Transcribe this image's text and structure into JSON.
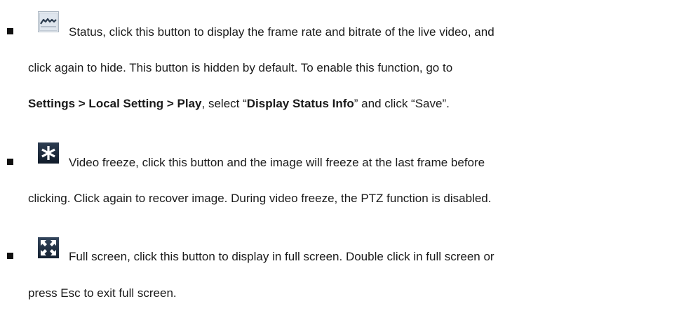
{
  "items": [
    {
      "icon": "status-waveform-icon",
      "line1": "Status, click this button to display the frame rate and bitrate of the live video, and",
      "line2": "click again to hide. This button is hidden by default. To enable this function, go to",
      "line3": {
        "path": "Settings > Local Setting > Play",
        "mid1": ", select “",
        "option": "Display Status Info",
        "mid2": "” and click “Save”."
      }
    },
    {
      "icon": "video-freeze-asterisk-icon",
      "line1": "Video freeze, click this button and the image will freeze at the last frame before",
      "line2": "clicking. Click again to recover image. During video freeze, the PTZ function is disabled."
    },
    {
      "icon": "full-screen-arrows-icon",
      "line1": "Full screen, click this button to display in full screen. Double click in full screen or",
      "line2": "press Esc to exit full screen."
    }
  ]
}
